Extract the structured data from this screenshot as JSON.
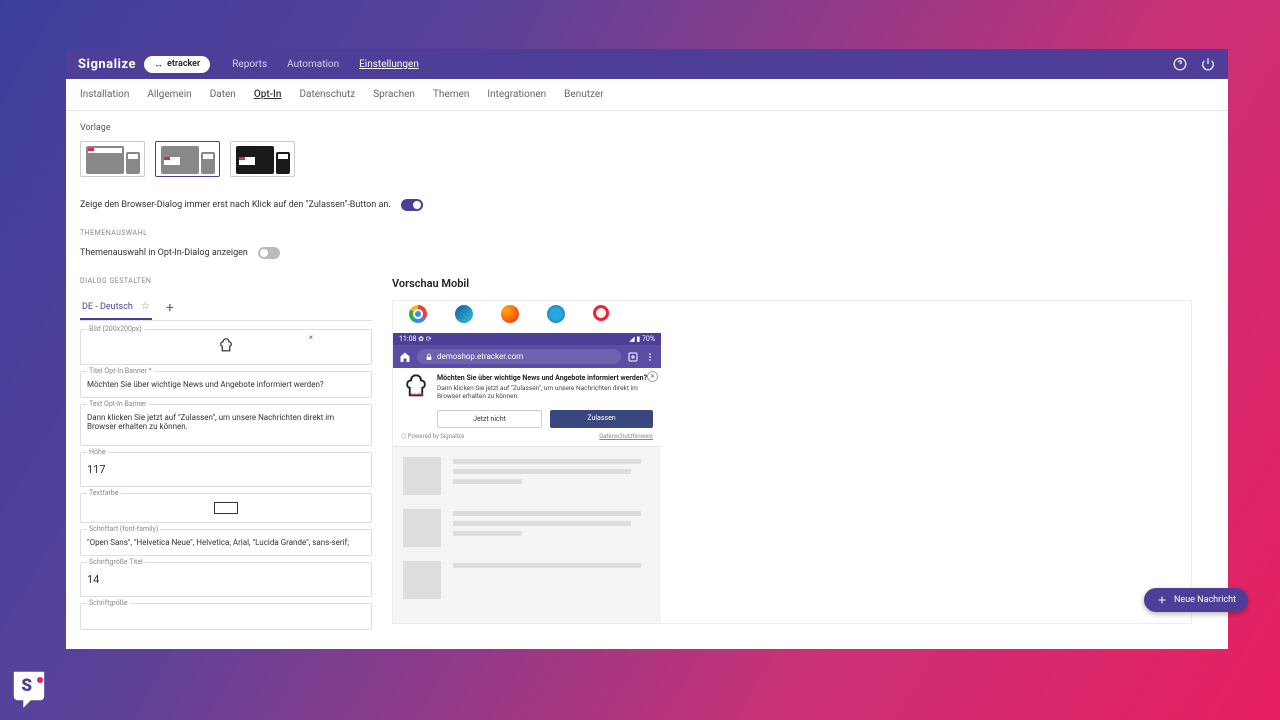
{
  "brand": "Signalize",
  "chip": "etracker",
  "topnav": {
    "reports": "Reports",
    "automation": "Automation",
    "settings": "Einstellungen"
  },
  "subtabs": {
    "installation": "Installation",
    "allgemein": "Allgemein",
    "daten": "Daten",
    "optin": "Opt-In",
    "datenschutz": "Datenschutz",
    "sprachen": "Sprachen",
    "themen": "Themen",
    "integrationen": "Integrationen",
    "benutzer": "Benutzer"
  },
  "vorlage_label": "Vorlage",
  "browser_toggle_label": "Zeige den Browser-Dialog immer erst nach Klick auf den \"Zulassen\"-Button an.",
  "themenauswahl_heading": "THEMENAUSWAHL",
  "themenauswahl_label": "Themenauswahl in Opt-In-Dialog anzeigen",
  "dialog_gestalten_heading": "DIALOG GESTALTEN",
  "lang_tab": "DE - Deutsch",
  "fields": {
    "bild_label": "Bild (200x200px)",
    "titel_label": "Titel Opt-In Banner *",
    "titel_value": "Möchten Sie über wichtige News und Angebote informiert werden?",
    "text_label": "Text Opt-In Banner",
    "text_value": "Dann klicken Sie jetzt auf \"Zulassen\", um unsere Nachrichten direkt im Browser erhalten zu können.",
    "hoehe_label": "Höhe",
    "hoehe_value": "117",
    "textfarbe_label": "Textfarbe",
    "schriftart_label": "Schriftart (font-family)",
    "schriftart_value": "\"Open Sans\", \"Helvetica Neue\", Helvetica, Arial, \"Lucida Grande\", sans-serif;",
    "schriftgroesse_titel_label": "Schriftgröße Titel",
    "schriftgroesse_titel_value": "14",
    "schriftgroesse_label": "Schriftgröße"
  },
  "preview": {
    "title": "Vorschau Mobil",
    "phone_time": "11:08",
    "phone_battery": "70%",
    "phone_url": "demoshop.etracker.com",
    "optin_title": "Möchten Sie über wichtige News und Angebote informiert werden?",
    "optin_body": "Dann klicken Sie jetzt auf \"Zulassen\", um unsere Nachrichten direkt im Browser erhalten zu können.",
    "btn_deny": "Jetzt nicht",
    "btn_allow": "Zulassen",
    "powered": "Powered by Signalize",
    "privacy": "Datenschutzhinweis"
  },
  "fab": "Neue Nachricht"
}
